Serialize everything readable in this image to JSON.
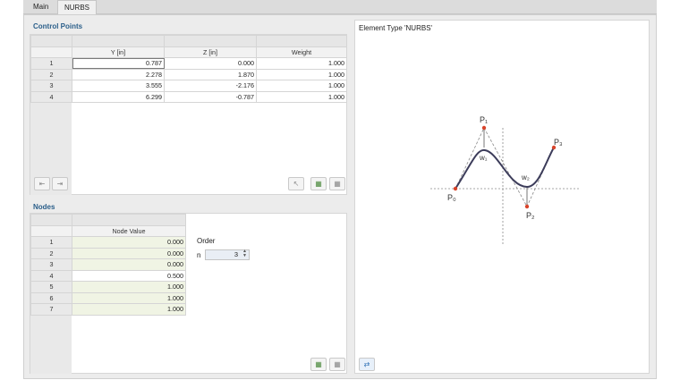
{
  "tabs": [
    {
      "label": "Main"
    },
    {
      "label": "NURBS"
    }
  ],
  "control_points": {
    "title": "Control Points",
    "headers": [
      "Y [in]",
      "Z [in]",
      "Weight"
    ],
    "rows": [
      {
        "no": "1",
        "y": "0.787",
        "z": "0.000",
        "w": "1.000"
      },
      {
        "no": "2",
        "y": "2.278",
        "z": "1.870",
        "w": "1.000"
      },
      {
        "no": "3",
        "y": "3.555",
        "z": "-2.176",
        "w": "1.000"
      },
      {
        "no": "4",
        "y": "6.299",
        "z": "-0.787",
        "w": "1.000"
      }
    ]
  },
  "nodes": {
    "title": "Nodes",
    "header": "Node Value",
    "rows": [
      {
        "no": "1",
        "v": "0.000"
      },
      {
        "no": "2",
        "v": "0.000"
      },
      {
        "no": "3",
        "v": "0.000"
      },
      {
        "no": "4",
        "v": "0.500"
      },
      {
        "no": "5",
        "v": "1.000"
      },
      {
        "no": "6",
        "v": "1.000"
      },
      {
        "no": "7",
        "v": "1.000"
      }
    ]
  },
  "order": {
    "label": "Order",
    "param": "n",
    "value": "3"
  },
  "diagram": {
    "title": "Element Type 'NURBS'",
    "labels": {
      "p0": "P₀",
      "p1": "P₁",
      "p2": "P₂",
      "p3": "P₃",
      "w1": "w₁",
      "w2": "w₂"
    },
    "curve_color": "#3c3c5a",
    "point_color": "#d9442b"
  },
  "icons": {
    "insert_before": "⇤",
    "insert_after": "⇥",
    "pick": "↖",
    "import": "▦",
    "export": "▦",
    "swap": "⇄"
  }
}
